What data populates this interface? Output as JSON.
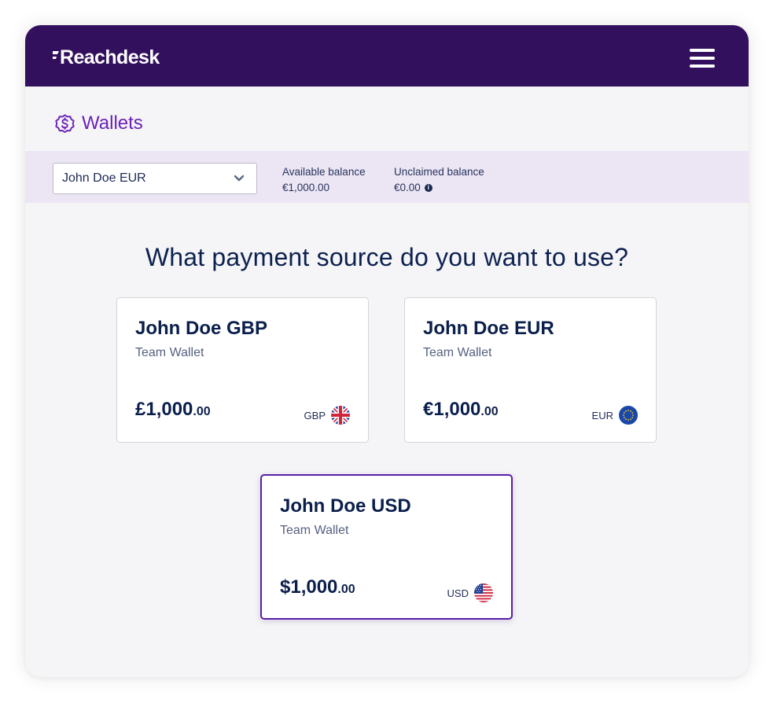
{
  "brand": {
    "logo_text": "Reachdesk"
  },
  "header": {
    "menu_icon": "hamburger-menu-icon"
  },
  "page": {
    "title": "Wallets",
    "title_icon": "dollar-badge-icon"
  },
  "balance_bar": {
    "selected_wallet": "John Doe EUR",
    "available_label": "Available balance",
    "available_value": "€1,000.00",
    "unclaimed_label": "Unclaimed balance",
    "unclaimed_value": "€0.00",
    "info_icon": "info-icon"
  },
  "main": {
    "question": "What payment source do you want to use?",
    "cards": [
      {
        "name": "John Doe GBP",
        "subtitle": "Team Wallet",
        "amount_main": "£1,000",
        "amount_decimals": ".00",
        "currency": "GBP",
        "flag_icon": "uk-flag-icon",
        "selected": false
      },
      {
        "name": "John Doe EUR",
        "subtitle": "Team Wallet",
        "amount_main": "€1,000",
        "amount_decimals": ".00",
        "currency": "EUR",
        "flag_icon": "eu-flag-icon",
        "selected": false
      },
      {
        "name": "John Doe USD",
        "subtitle": "Team Wallet",
        "amount_main": "$1,000",
        "amount_decimals": ".00",
        "currency": "USD",
        "flag_icon": "us-flag-icon",
        "selected": true
      }
    ]
  },
  "colors": {
    "header_bg": "#33105e",
    "accent_purple": "#6a22b8",
    "balance_bar_bg": "#ece5f4",
    "text_navy": "#0b1f4c",
    "selected_border": "#5b1ea6"
  }
}
